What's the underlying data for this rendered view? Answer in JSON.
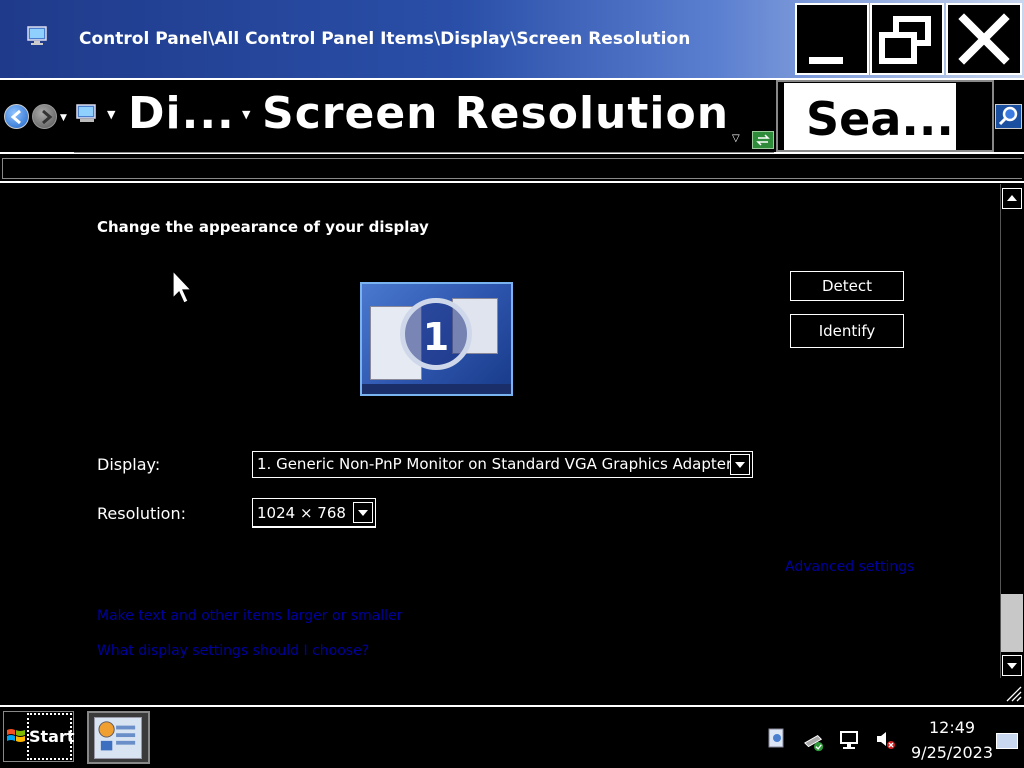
{
  "window": {
    "title": "Control Panel\\All Control Panel Items\\Display\\Screen Resolution",
    "buttons": {
      "minimize": "minimize",
      "maximize": "restore",
      "close": "close"
    }
  },
  "address_bar": {
    "breadcrumb_1": "Di...",
    "breadcrumb_2": "Screen Resolution",
    "search_placeholder": "Sea..."
  },
  "content": {
    "heading": "Change the appearance of your display",
    "monitor_number": "1",
    "detect_button": "Detect",
    "identify_button": "Identify",
    "display_label": "Display:",
    "display_value": "1. Generic Non-PnP Monitor on Standard VGA Graphics Adapter",
    "resolution_label": "Resolution:",
    "resolution_value": "1024 × 768",
    "advanced_settings_link": "Advanced settings",
    "make_text_link": "Make text and other items larger or smaller",
    "what_settings_link": "What display settings should I choose?"
  },
  "taskbar": {
    "start_label": "Start",
    "clock_time": "12:49",
    "clock_date": "9/25/2023"
  },
  "colors": {
    "title_gradient_start": "#1f3a8a",
    "title_gradient_end": "#c8d6ee",
    "background": "#000000",
    "foreground": "#ffffff",
    "link": "#00009c"
  }
}
